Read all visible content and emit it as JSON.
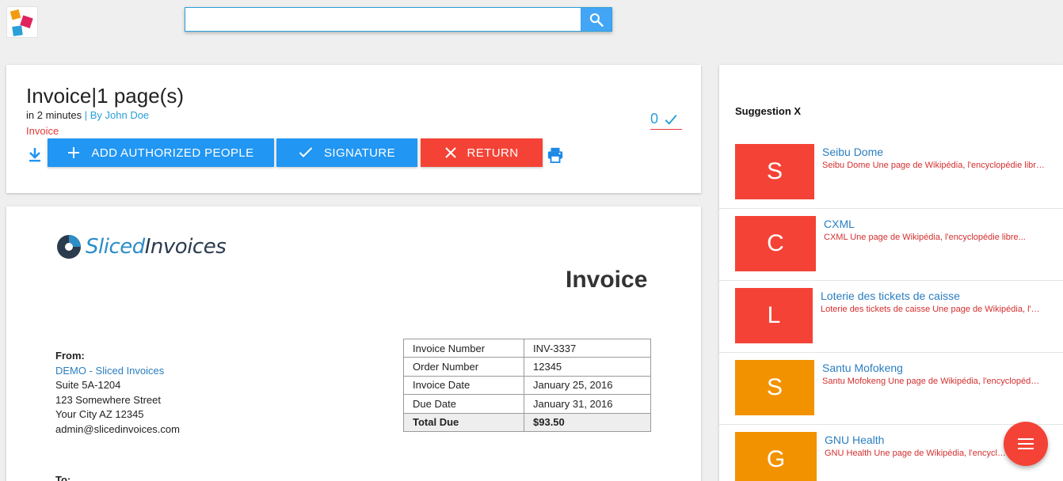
{
  "search": {
    "value": "",
    "placeholder": ""
  },
  "document": {
    "title": "Invoice|1 page(s)",
    "time": "in 2 minutes",
    "separator": "|",
    "author": "By John Doe",
    "type": "Invoice",
    "validation_count": "0"
  },
  "actions": {
    "add_people_label": "ADD AUTHORIZED PEOPLE",
    "signature_label": "SIGNATURE",
    "return_label": "RETURN"
  },
  "invoice": {
    "brand_part1": "Sliced",
    "brand_part2": "Invoices",
    "heading": "Invoice",
    "from_label": "From:",
    "from_company": "DEMO - Sliced Invoices",
    "from_lines": [
      "Suite 5A-1204",
      "123 Somewhere Street",
      "Your City AZ 12345",
      "admin@slicedinvoices.com"
    ],
    "to_label": "To:",
    "table": [
      {
        "label": "Invoice Number",
        "value": "INV-3337"
      },
      {
        "label": "Order Number",
        "value": "12345"
      },
      {
        "label": "Invoice Date",
        "value": "January 25, 2016"
      },
      {
        "label": "Due Date",
        "value": "January 31, 2016"
      },
      {
        "label": "Total Due",
        "value": "$93.50"
      }
    ]
  },
  "suggestions": {
    "title": "Suggestion X",
    "items": [
      {
        "letter": "S",
        "color": "#f44336",
        "title": "Seibu Dome",
        "desc": "Seibu Dome Une page de Wikipédia, l'encyclopédie libre..."
      },
      {
        "letter": "C",
        "color": "#f44336",
        "title": "CXML",
        "desc": "CXML Une page de Wikipédia, l'encyclopédie libre..."
      },
      {
        "letter": "L",
        "color": "#f44336",
        "title": "Loterie des tickets de caisse",
        "desc": "Loterie des tickets de caisse Une page de Wikipédia, l'encyclopédie libre..."
      },
      {
        "letter": "S",
        "color": "#f39200",
        "title": "Santu Mofokeng",
        "desc": "Santu Mofokeng Une page de Wikipédia, l'encyclopédie libre..."
      },
      {
        "letter": "G",
        "color": "#f39200",
        "title": "GNU Health",
        "desc": "GNU Health Une page de Wikipédia, l'encyclopédie libre..."
      }
    ]
  },
  "icons": {
    "search": "search-icon",
    "check": "check-icon",
    "download": "download-icon",
    "add": "plus-icon",
    "signature": "check-icon",
    "return": "close-icon",
    "print": "print-icon",
    "menu": "menu-icon"
  },
  "colors": {
    "primary": "#2196f3",
    "danger": "#f44336",
    "warning": "#f39200",
    "link": "#2a7ec0"
  }
}
